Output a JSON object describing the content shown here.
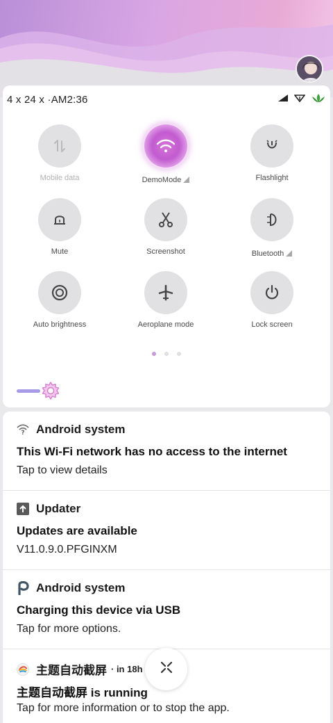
{
  "status_bar": {
    "left_text": "4 x 24 x ·AM2:36",
    "icons": [
      "signal-icon",
      "wifi-signal-icon",
      "lotus-icon"
    ]
  },
  "quick_settings": {
    "tiles": [
      {
        "label": "Mobile data",
        "icon": "mobile-data-icon",
        "state": "disabled"
      },
      {
        "label": "DemoMode",
        "icon": "wifi-icon",
        "state": "active",
        "has_indicator": true
      },
      {
        "label": "Flashlight",
        "icon": "flashlight-icon",
        "state": "off"
      },
      {
        "label": "Mute",
        "icon": "bell-icon",
        "state": "off"
      },
      {
        "label": "Screenshot",
        "icon": "scissors-icon",
        "state": "off"
      },
      {
        "label": "Bluetooth",
        "icon": "bluetooth-icon",
        "state": "off",
        "has_indicator": true
      },
      {
        "label": "Auto brightness",
        "icon": "brightness-icon",
        "state": "off"
      },
      {
        "label": "Aeroplane mode",
        "icon": "airplane-icon",
        "state": "off"
      },
      {
        "label": "Lock screen",
        "icon": "power-icon",
        "state": "off"
      }
    ],
    "pager": {
      "pages": 3,
      "current": 1
    },
    "brightness_level": 0.08,
    "accent_color": "#c25bd0"
  },
  "notifications": [
    {
      "app": "Android system",
      "icon": "wifi-question-icon",
      "time": "",
      "title": "This Wi-Fi network has no access to the internet",
      "body": "Tap to view details"
    },
    {
      "app": "Updater",
      "icon": "upload-arrow-icon",
      "time": "",
      "title": "Updates are available",
      "body": "V11.0.9.0.PFGINXM"
    },
    {
      "app": "Android system",
      "icon": "usb-p-icon",
      "time": "",
      "title": "Charging this device via USB",
      "body": "Tap for more options."
    },
    {
      "app": "主题自动截屏",
      "icon": "app-logo-icon",
      "time": "· in 18h",
      "title": "主题自动截屏 is running",
      "body": "Tap for more information or to stop the app."
    }
  ],
  "clear_all": {
    "icon": "clear-all-icon"
  }
}
